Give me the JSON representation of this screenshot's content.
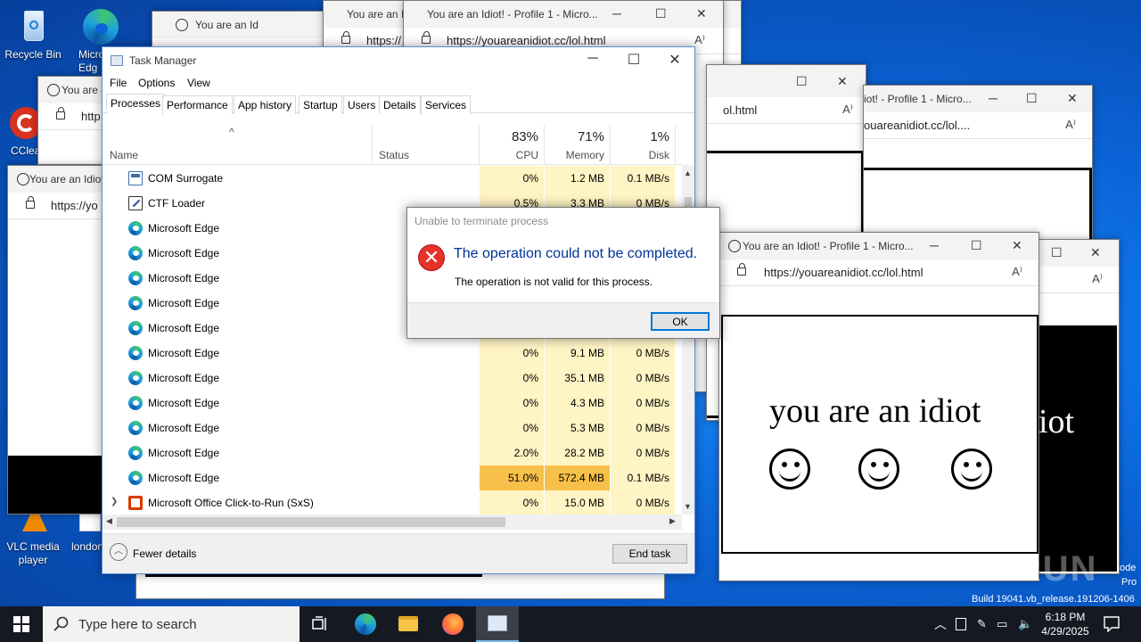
{
  "desktop_icons": [
    {
      "label": "Recycle Bin",
      "icon": "recycle-bin-icon"
    },
    {
      "label": "Micro Edg",
      "icon": "edge-icon"
    },
    {
      "label": "CClea",
      "icon": "ccleaner-icon"
    },
    {
      "label": "VLC media player",
      "icon": "vlc-icon"
    },
    {
      "label": "london",
      "icon": "file-icon"
    }
  ],
  "browser": {
    "title": "You are an Idiot! - Profile 1 - Micro...",
    "title_short": "You are an Id",
    "title_tiny": "You are an Idiot",
    "title_frag": "You are an I",
    "title_frag2": "iot! - Profile 1 - Micro...",
    "url": "https://youareanidiot.cc/lol.html",
    "url_short": "https://yo",
    "url_frag": "https://",
    "url_frag2": "http",
    "url_frag3": "ol.html",
    "url_frag4": "ouareanidiot.cc/lol....",
    "page_text": "you are an idiot",
    "page_text_frag": "iot"
  },
  "task_manager": {
    "title": "Task Manager",
    "menu": [
      "File",
      "Options",
      "View"
    ],
    "tabs": [
      "Processes",
      "Performance",
      "App history",
      "Startup",
      "Users",
      "Details",
      "Services"
    ],
    "active_tab": "Processes",
    "columns": {
      "name": "Name",
      "status": "Status",
      "cpu_pct": "83%",
      "cpu": "CPU",
      "mem_pct": "71%",
      "mem": "Memory",
      "disk_pct": "1%",
      "disk": "Disk"
    },
    "rows": [
      {
        "name": "COM Surrogate",
        "icon": "com-surrogate-icon",
        "cpu": "0%",
        "mem": "1.2 MB",
        "disk": "0.1 MB/s"
      },
      {
        "name": "CTF Loader",
        "icon": "ctf-loader-icon",
        "cpu": "0.5%",
        "mem": "3.3 MB",
        "disk": "0 MB/s"
      },
      {
        "name": "Microsoft Edge",
        "icon": "edge-icon",
        "cpu": "",
        "mem": "",
        "disk": ""
      },
      {
        "name": "Microsoft Edge",
        "icon": "edge-icon",
        "cpu": "",
        "mem": "",
        "disk": ""
      },
      {
        "name": "Microsoft Edge",
        "icon": "edge-icon",
        "cpu": "",
        "mem": "",
        "disk": ""
      },
      {
        "name": "Microsoft Edge",
        "icon": "edge-icon",
        "cpu": "",
        "mem": "",
        "disk": ""
      },
      {
        "name": "Microsoft Edge",
        "icon": "edge-icon",
        "cpu": "",
        "mem": "",
        "disk": ""
      },
      {
        "name": "Microsoft Edge",
        "icon": "edge-icon",
        "cpu": "0%",
        "mem": "9.1 MB",
        "disk": "0 MB/s"
      },
      {
        "name": "Microsoft Edge",
        "icon": "edge-icon",
        "cpu": "0%",
        "mem": "35.1 MB",
        "disk": "0 MB/s"
      },
      {
        "name": "Microsoft Edge",
        "icon": "edge-icon",
        "cpu": "0%",
        "mem": "4.3 MB",
        "disk": "0 MB/s"
      },
      {
        "name": "Microsoft Edge",
        "icon": "edge-icon",
        "cpu": "0%",
        "mem": "5.3 MB",
        "disk": "0 MB/s"
      },
      {
        "name": "Microsoft Edge",
        "icon": "edge-icon",
        "cpu": "2.0%",
        "mem": "28.2 MB",
        "disk": "0 MB/s"
      },
      {
        "name": "Microsoft Edge",
        "icon": "edge-icon",
        "cpu": "51.0%",
        "mem": "572.4 MB",
        "disk": "0.1 MB/s",
        "highlight": true
      },
      {
        "name": "Microsoft Office Click-to-Run (SxS)",
        "icon": "office-icon",
        "cpu": "0%",
        "mem": "15.0 MB",
        "disk": "0 MB/s",
        "expandable": true
      }
    ],
    "fewer_details": "Fewer details",
    "end_task": "End task"
  },
  "dialog": {
    "title": "Unable to terminate process",
    "main": "The operation could not be completed.",
    "sub": "The operation is not valid for this process.",
    "ok": "OK"
  },
  "taskbar": {
    "search_placeholder": "Type here to search",
    "time": "6:18 PM",
    "date": "4/29/2025"
  },
  "watermark": "ANY RUN",
  "build_text": "Build 19041.vb_release.191206-1406",
  "side_text": [
    "ode",
    "Pro"
  ],
  "colors": {
    "cpu_heat_low": "#fff4c4",
    "cpu_heat_high": "#f7c04a",
    "accent": "#0078d7",
    "error": "#e8312b"
  }
}
